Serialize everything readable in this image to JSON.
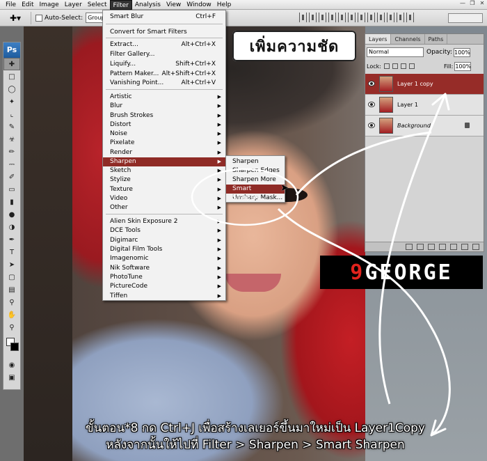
{
  "menubar": {
    "items": [
      "File",
      "Edit",
      "Image",
      "Layer",
      "Select",
      "Filter",
      "Analysis",
      "View",
      "Window",
      "Help"
    ],
    "active": "Filter"
  },
  "options_bar": {
    "auto_select_label": "Auto-Select:",
    "auto_select_value": "Group"
  },
  "toolbox": {
    "logo": "Ps"
  },
  "filter_menu": {
    "items": [
      {
        "label": "Smart Blur",
        "shortcut": "Ctrl+F"
      },
      {
        "label": "Convert for Smart Filters"
      },
      {
        "label": "Extract...",
        "shortcut": "Alt+Ctrl+X"
      },
      {
        "label": "Filter Gallery..."
      },
      {
        "label": "Liquify...",
        "shortcut": "Shift+Ctrl+X"
      },
      {
        "label": "Pattern Maker...",
        "shortcut": "Alt+Shift+Ctrl+X"
      },
      {
        "label": "Vanishing Point...",
        "shortcut": "Alt+Ctrl+V"
      },
      {
        "label": "Artistic",
        "submenu": true
      },
      {
        "label": "Blur",
        "submenu": true
      },
      {
        "label": "Brush Strokes",
        "submenu": true
      },
      {
        "label": "Distort",
        "submenu": true
      },
      {
        "label": "Noise",
        "submenu": true
      },
      {
        "label": "Pixelate",
        "submenu": true
      },
      {
        "label": "Render",
        "submenu": true
      },
      {
        "label": "Sharpen",
        "submenu": true,
        "highlighted": true
      },
      {
        "label": "Sketch",
        "submenu": true
      },
      {
        "label": "Stylize",
        "submenu": true
      },
      {
        "label": "Texture",
        "submenu": true
      },
      {
        "label": "Video",
        "submenu": true
      },
      {
        "label": "Other",
        "submenu": true
      },
      {
        "label": "Alien Skin Exposure 2",
        "submenu": true
      },
      {
        "label": "DCE Tools",
        "submenu": true
      },
      {
        "label": "Digimarc",
        "submenu": true
      },
      {
        "label": "Digital Film Tools",
        "submenu": true
      },
      {
        "label": "Imagenomic",
        "submenu": true
      },
      {
        "label": "Nik Software",
        "submenu": true
      },
      {
        "label": "PhotoTune",
        "submenu": true
      },
      {
        "label": "PictureCode",
        "submenu": true
      },
      {
        "label": "Tiffen",
        "submenu": true
      }
    ]
  },
  "sharpen_menu": {
    "items": [
      {
        "label": "Sharpen"
      },
      {
        "label": "Sharpen Edges"
      },
      {
        "label": "Sharpen More"
      },
      {
        "label": "Smart Sharpen...",
        "highlighted": true
      },
      {
        "label": "Unsharp Mask..."
      }
    ]
  },
  "title_badge": "เพิ่มความชัด",
  "layers_panel": {
    "tabs": [
      "Layers",
      "Channels",
      "Paths"
    ],
    "active_tab": "Layers",
    "blend_mode": "Normal",
    "opacity_label": "Opacity:",
    "opacity_value": "100%",
    "lock_label": "Lock:",
    "fill_label": "Fill:",
    "fill_value": "100%",
    "layers": [
      {
        "name": "Layer 1 copy",
        "selected": true
      },
      {
        "name": "Layer 1"
      },
      {
        "name": "Background",
        "locked": true,
        "italic": true
      }
    ]
  },
  "logo": {
    "nine": "9",
    "rest": "GEORGE"
  },
  "caption": {
    "line1": "ขั้นตอน*8 กด Ctrl+J เพื่อสร้างเลเยอร์ขึ้นมาใหม่เป็น Layer1Copy",
    "line2": "หลังจากนั้นให้ไปที่ Filter > Sharpen > Smart Sharpen"
  },
  "colors": {
    "menu_highlight": "#8f2b26",
    "logo_red": "#e0231d"
  }
}
